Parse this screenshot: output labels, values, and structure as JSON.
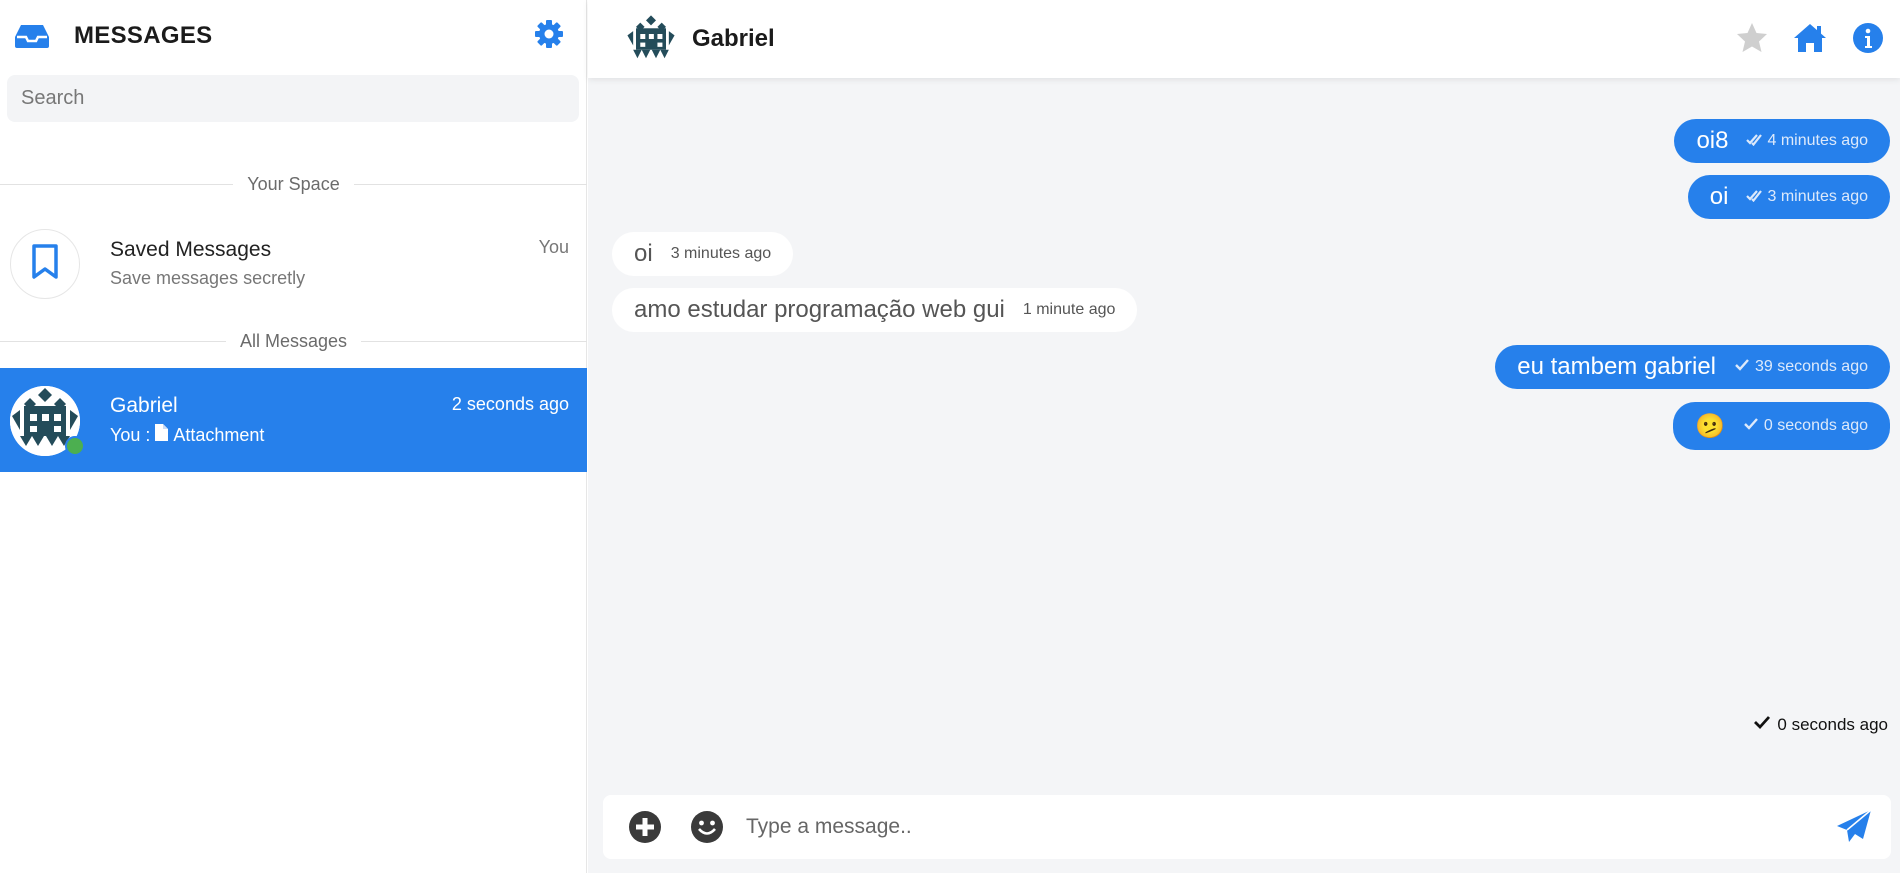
{
  "sidebar": {
    "title": "MESSAGES",
    "search_placeholder": "Search",
    "your_space_label": "Your Space",
    "all_messages_label": "All Messages",
    "saved": {
      "name": "Saved Messages",
      "subtitle": "Save messages secretly",
      "tag": "You"
    },
    "contacts": [
      {
        "name": "Gabriel",
        "time": "2 seconds ago",
        "preview_prefix": "You :",
        "preview_text": "Attachment",
        "online": true
      }
    ]
  },
  "chat": {
    "contact_name": "Gabriel",
    "messages": [
      {
        "direction": "out",
        "text": "oi8",
        "time": "4 minutes ago",
        "status": "read"
      },
      {
        "direction": "out",
        "text": "oi",
        "time": "3 minutes ago",
        "status": "read"
      },
      {
        "direction": "in",
        "text": "oi",
        "time": "3 minutes ago"
      },
      {
        "direction": "in",
        "text": "amo estudar programação web gui",
        "time": "1 minute ago"
      },
      {
        "direction": "out",
        "text": "eu tambem gabriel",
        "time": "39 seconds ago",
        "status": "sent"
      },
      {
        "direction": "out",
        "text": "🫤",
        "time": "0 seconds ago",
        "status": "sent"
      }
    ],
    "status_line": "0 seconds ago",
    "composer_placeholder": "Type a message.."
  },
  "colors": {
    "accent": "#2680eb",
    "online": "#4caf50",
    "chat_bg": "#f4f5f7",
    "star_inactive": "#cfcfcf"
  },
  "icons": [
    "inbox-icon",
    "gear-icon",
    "bookmark-icon",
    "file-icon",
    "star-icon",
    "home-icon",
    "info-icon",
    "check-icon",
    "double-check-icon",
    "plus-icon",
    "emoji-icon",
    "send-icon"
  ]
}
